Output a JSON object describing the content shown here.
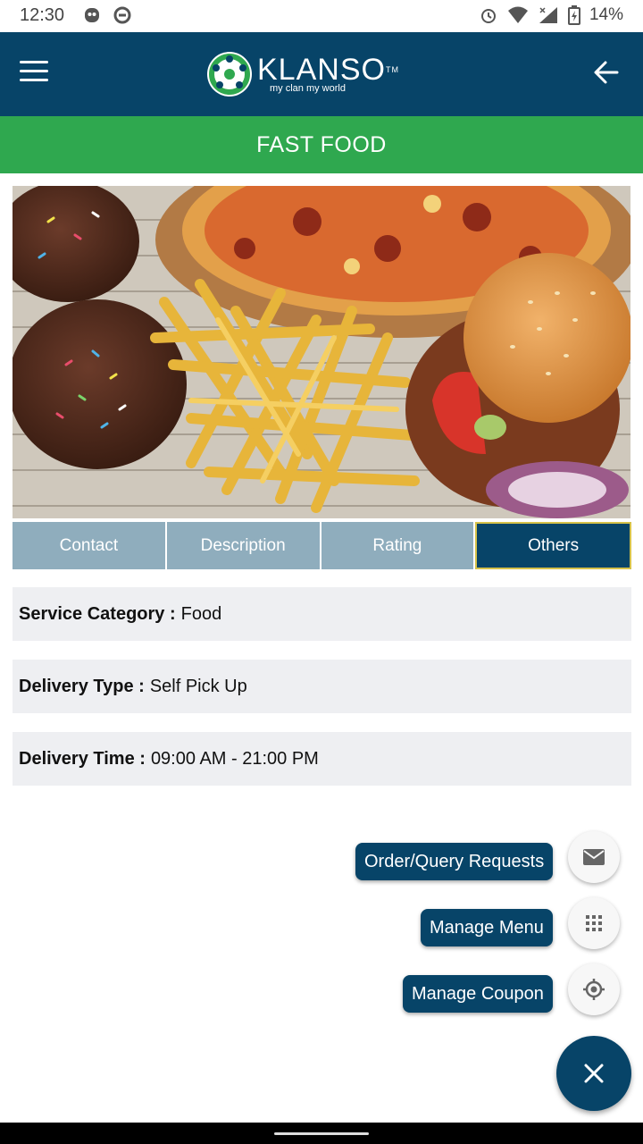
{
  "status_bar": {
    "time": "12:30",
    "battery_percent": "14%",
    "left_icons": [
      "notification-app-icon",
      "sync-icon"
    ],
    "right_icons": [
      "alarm-icon",
      "wifi-icon",
      "signal-icon",
      "battery-charging-icon"
    ]
  },
  "app_bar": {
    "logo_name": "KLANSO",
    "logo_tm": "TM",
    "logo_tagline": "my clan my world",
    "menu_icon": "hamburger-icon",
    "back_icon": "arrow-back-icon",
    "background_color": "#074468"
  },
  "category": {
    "title": "FAST FOOD",
    "color": "#2fa84f"
  },
  "tabs": [
    {
      "label": "Contact",
      "active": false
    },
    {
      "label": "Description",
      "active": false
    },
    {
      "label": "Rating",
      "active": false
    },
    {
      "label": "Others",
      "active": true
    }
  ],
  "details": [
    {
      "label": "Service Category :",
      "value": "Food"
    },
    {
      "label": "Delivery Type :",
      "value": "Self Pick Up"
    },
    {
      "label": "Delivery Time :",
      "value": "09:00 AM - 21:00 PM"
    }
  ],
  "fab_menu": {
    "items": [
      {
        "label": "Order/Query Requests",
        "icon": "mail-icon"
      },
      {
        "label": "Manage Menu",
        "icon": "grid-icon"
      },
      {
        "label": "Manage Coupon",
        "icon": "location-target-icon"
      }
    ],
    "main_icon": "close-icon"
  }
}
